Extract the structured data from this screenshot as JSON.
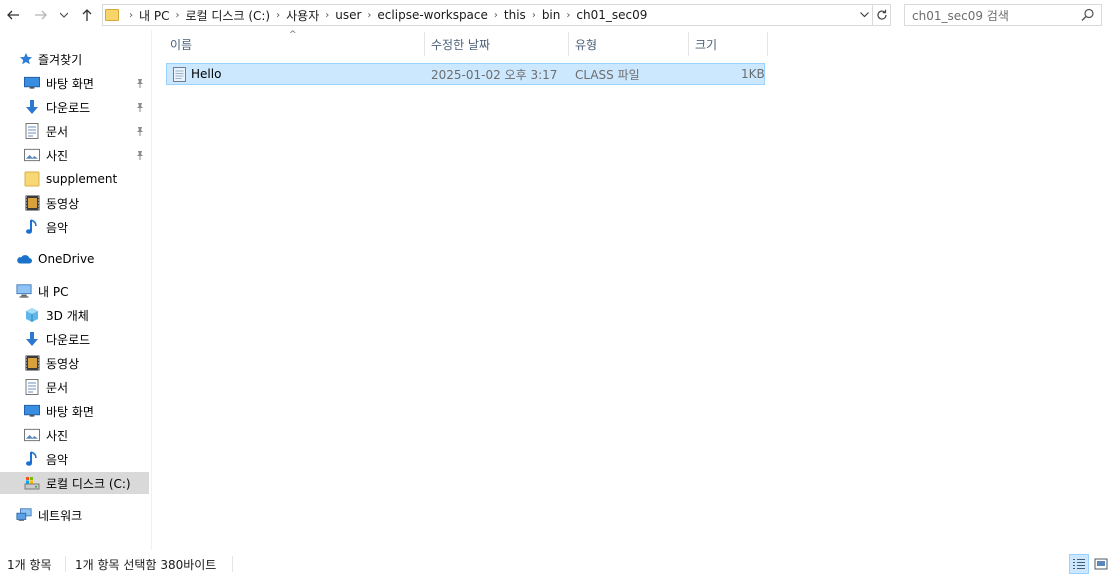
{
  "address": {
    "crumbs": [
      "내 PC",
      "로컬 디스크 (C:)",
      "사용자",
      "user",
      "eclipse-workspace",
      "this",
      "bin",
      "ch01_sec09"
    ]
  },
  "search": {
    "placeholder": "ch01_sec09 검색"
  },
  "sidebar": {
    "quick_access": {
      "label": "즐겨찾기",
      "items": [
        {
          "label": "바탕 화면",
          "icon": "desktop-icon",
          "pinned": true
        },
        {
          "label": "다운로드",
          "icon": "download-icon",
          "pinned": true
        },
        {
          "label": "문서",
          "icon": "document-icon",
          "pinned": true
        },
        {
          "label": "사진",
          "icon": "pictures-icon",
          "pinned": true
        },
        {
          "label": "supplement",
          "icon": "folder-icon",
          "pinned": false
        },
        {
          "label": "동영상",
          "icon": "video-icon",
          "pinned": false
        },
        {
          "label": "음악",
          "icon": "music-icon",
          "pinned": false
        }
      ]
    },
    "onedrive": {
      "label": "OneDrive"
    },
    "this_pc": {
      "label": "내 PC",
      "items": [
        {
          "label": "3D 개체",
          "icon": "3d-objects-icon"
        },
        {
          "label": "다운로드",
          "icon": "download-icon"
        },
        {
          "label": "동영상",
          "icon": "video-icon"
        },
        {
          "label": "문서",
          "icon": "document-icon"
        },
        {
          "label": "바탕 화면",
          "icon": "desktop-icon"
        },
        {
          "label": "사진",
          "icon": "pictures-icon"
        },
        {
          "label": "음악",
          "icon": "music-icon"
        },
        {
          "label": "로컬 디스크 (C:)",
          "icon": "drive-icon",
          "selected": true
        }
      ]
    },
    "network": {
      "label": "네트워크"
    }
  },
  "columns": {
    "name": "이름",
    "date": "수정한 날짜",
    "type": "유형",
    "size": "크기"
  },
  "files": [
    {
      "name": "Hello",
      "date": "2025-01-02 오후 3:17",
      "type": "CLASS 파일",
      "size": "1KB",
      "selected": true
    }
  ],
  "status": {
    "count": "1개 항목",
    "selection": "1개 항목 선택함 380바이트"
  },
  "colors": {
    "selection_bg": "#cce8ff",
    "selection_border": "#99d1ff",
    "header_text": "#4c607a"
  }
}
